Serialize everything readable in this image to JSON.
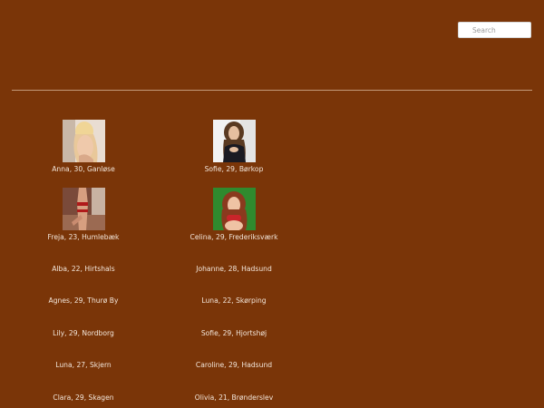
{
  "colors": {
    "background": "#7a3508",
    "divider": "#c49a7a",
    "caption_text": "#f3e6da"
  },
  "search": {
    "placeholder": "Search",
    "value": ""
  },
  "profiles": [
    {
      "caption": "Anna, 30, Ganløse",
      "photo": "blonde-woman-photo"
    },
    {
      "caption": "Sofie, 29, Børkop",
      "photo": "dark-haired-woman-photo"
    },
    {
      "caption": "Freja, 23, Humlebæk",
      "photo": "woman-lingerie-photo"
    },
    {
      "caption": "Celina, 29, Frederiksværk",
      "photo": "redhead-woman-green-photo"
    },
    {
      "caption": "Alba, 22, Hirtshals"
    },
    {
      "caption": "Johanne, 28, Hadsund"
    },
    {
      "caption": "Agnes, 29, Thurø By"
    },
    {
      "caption": "Luna, 22, Skørping"
    },
    {
      "caption": "Lily, 29, Nordborg"
    },
    {
      "caption": "Sofie, 29, Hjortshøj"
    },
    {
      "caption": "Luna, 27, Skjern"
    },
    {
      "caption": "Caroline, 29, Hadsund"
    },
    {
      "caption": "Clara, 29, Skagen"
    },
    {
      "caption": "Olivia, 21, Brønderslev"
    }
  ]
}
